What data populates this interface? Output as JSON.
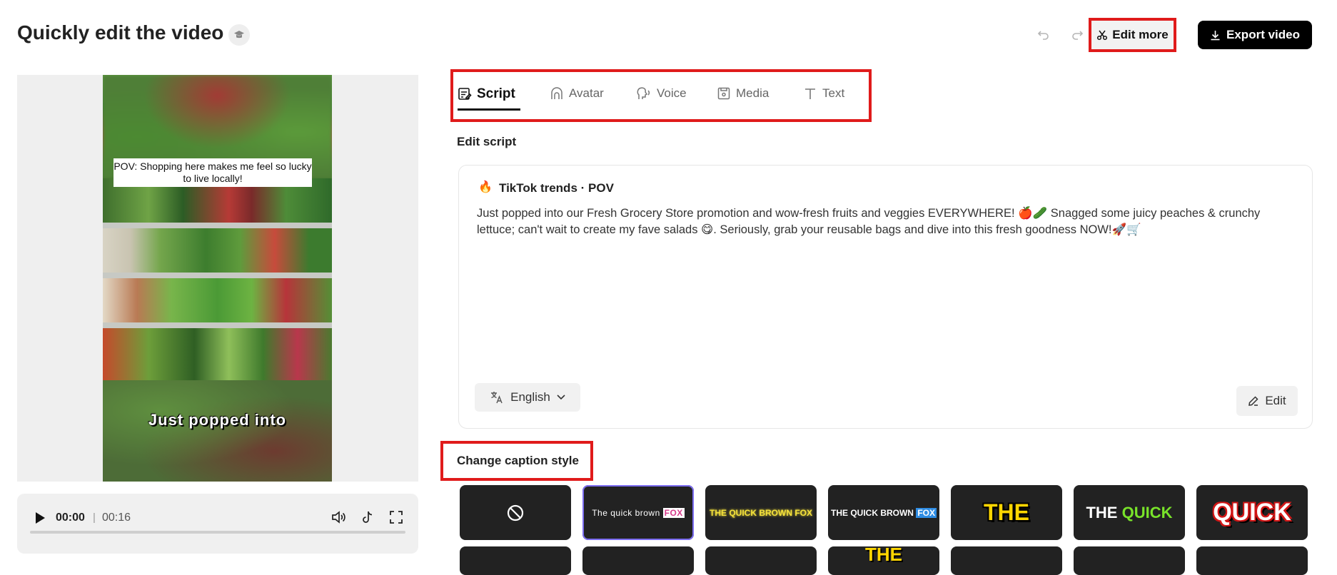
{
  "header": {
    "title": "Quickly edit the video",
    "edit_more_label": "Edit more",
    "export_label": "Export video"
  },
  "preview": {
    "pov_caption": "POV: Shopping here makes me feel so lucky to live locally!",
    "word_caption": "Just popped into"
  },
  "player": {
    "current_time": "00:00",
    "separator": "|",
    "total_time": "00:16",
    "progress_fraction": 0
  },
  "tabs": [
    {
      "label": "Script",
      "icon": "script-icon",
      "active": true
    },
    {
      "label": "Avatar",
      "icon": "avatar-icon",
      "active": false
    },
    {
      "label": "Voice",
      "icon": "voice-icon",
      "active": false
    },
    {
      "label": "Media",
      "icon": "media-icon",
      "active": false
    },
    {
      "label": "Text",
      "icon": "text-icon",
      "active": false
    }
  ],
  "script": {
    "section_label": "Edit script",
    "trend_emoji": "🔥",
    "trend_label": "TikTok trends · POV",
    "text": "Just popped into our Fresh Grocery Store promotion and wow-fresh fruits and veggies EVERYWHERE! 🍎🥒 Snagged some juicy peaches & crunchy lettuce; can't wait to create my fave salads 😋. Seriously, grab your reusable bags and dive into this fresh goodness NOW!🚀🛒",
    "language": "English",
    "edit_label": "Edit"
  },
  "caption_style": {
    "section_label": "Change caption style",
    "styles": [
      {
        "label": "",
        "icon": "none-icon"
      },
      {
        "label": "The quick brown",
        "highlight": "FOX",
        "selected": true
      },
      {
        "label": "THE QUICK BROWN FOX"
      },
      {
        "label": "THE QUICK BROWN",
        "highlight": "FOX"
      },
      {
        "label": "THE"
      },
      {
        "label": "THE",
        "highlight": "QUICK"
      },
      {
        "label": "QUICK"
      }
    ],
    "row2_labels": [
      "",
      "",
      "",
      "THE",
      "",
      "",
      ""
    ]
  },
  "colors": {
    "highlight_red": "#e01b1b",
    "selected_outline": "#7b6cf0",
    "export_bg": "#000000"
  }
}
